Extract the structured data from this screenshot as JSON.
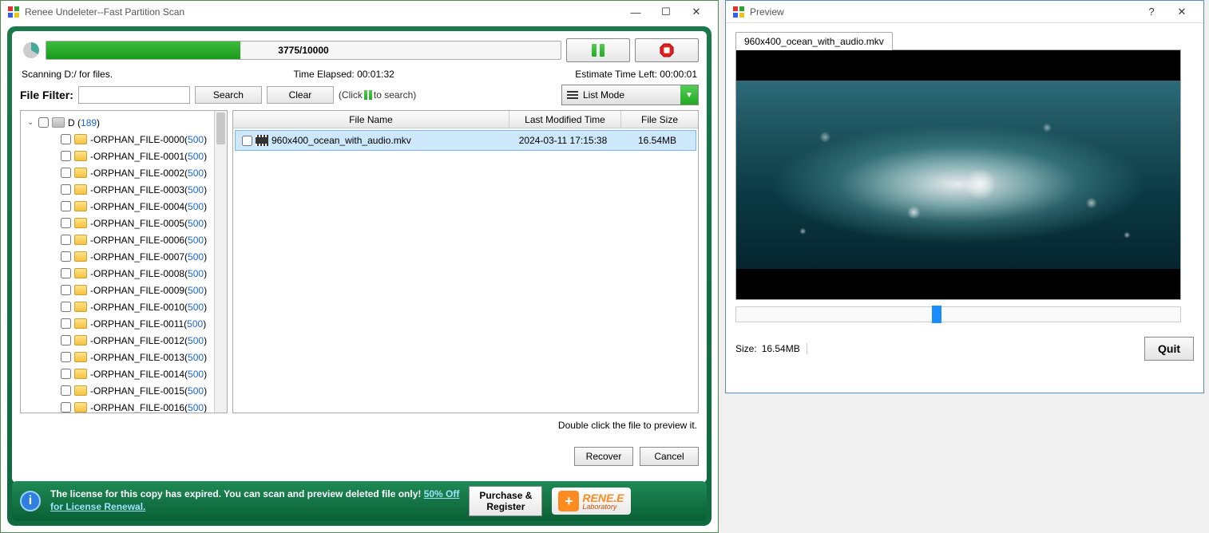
{
  "main": {
    "title": "Renee Undeleter--Fast Partition Scan",
    "progress": {
      "current": 3775,
      "total": 10000,
      "text": "3775/10000",
      "percent": 37.75
    },
    "scanning_text": "Scanning D:/ for files.",
    "time_elapsed_label": "Time Elapsed: 00:01:32",
    "estimate_label": "Estimate Time Left: 00:00:01",
    "filter_label": "File  Filter:",
    "search_btn": "Search",
    "clear_btn": "Clear",
    "search_hint_pre": "(Click",
    "search_hint_post": "to search)",
    "list_mode": "List Mode",
    "tree": {
      "root_name": "D",
      "root_count": "189",
      "items": [
        {
          "name": "-ORPHAN_FILE-0000",
          "count": "500"
        },
        {
          "name": "-ORPHAN_FILE-0001",
          "count": "500"
        },
        {
          "name": "-ORPHAN_FILE-0002",
          "count": "500"
        },
        {
          "name": "-ORPHAN_FILE-0003",
          "count": "500"
        },
        {
          "name": "-ORPHAN_FILE-0004",
          "count": "500"
        },
        {
          "name": "-ORPHAN_FILE-0005",
          "count": "500"
        },
        {
          "name": "-ORPHAN_FILE-0006",
          "count": "500"
        },
        {
          "name": "-ORPHAN_FILE-0007",
          "count": "500"
        },
        {
          "name": "-ORPHAN_FILE-0008",
          "count": "500"
        },
        {
          "name": "-ORPHAN_FILE-0009",
          "count": "500"
        },
        {
          "name": "-ORPHAN_FILE-0010",
          "count": "500"
        },
        {
          "name": "-ORPHAN_FILE-0011",
          "count": "500"
        },
        {
          "name": "-ORPHAN_FILE-0012",
          "count": "500"
        },
        {
          "name": "-ORPHAN_FILE-0013",
          "count": "500"
        },
        {
          "name": "-ORPHAN_FILE-0014",
          "count": "500"
        },
        {
          "name": "-ORPHAN_FILE-0015",
          "count": "500"
        },
        {
          "name": "-ORPHAN_FILE-0016",
          "count": "500"
        }
      ]
    },
    "file_headers": {
      "name": "File Name",
      "date": "Last Modified Time",
      "size": "File Size"
    },
    "files": [
      {
        "name": "960x400_ocean_with_audio.mkv",
        "date": "2024-03-11 17:15:38",
        "size": "16.54MB"
      }
    ],
    "double_click_hint": "Double click the file to preview it.",
    "recover_btn": "Recover",
    "cancel_btn": "Cancel",
    "footer": {
      "text": "The license for this copy has expired. You can scan and preview deleted file only! ",
      "link1": "50% Off",
      "link2": "for License Renewal.",
      "purchase_btn": "Purchase & Register",
      "logo1": "RENE.E",
      "logo2": "Laboratory"
    }
  },
  "preview": {
    "title": "Preview",
    "tab": "960x400_ocean_with_audio.mkv",
    "size_label": "Size:",
    "size_value": "16.54MB",
    "quit_btn": "Quit"
  }
}
